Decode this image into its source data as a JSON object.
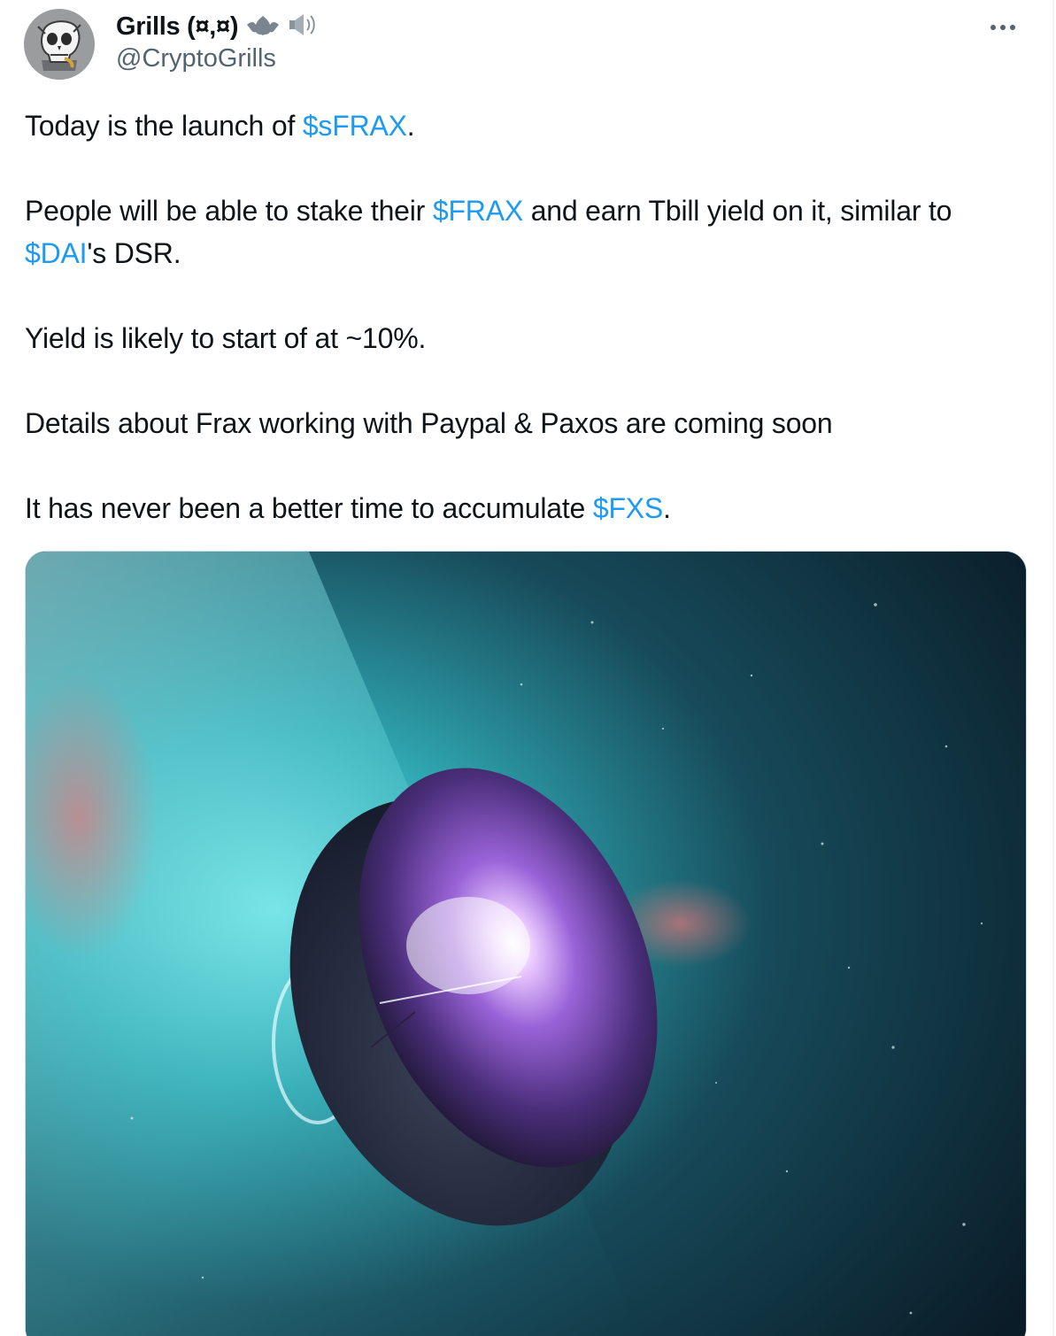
{
  "tweet": {
    "author": {
      "display_name": "Grills (¤,¤)",
      "badge_icons": [
        "bat-icon",
        "speaker-icon"
      ],
      "handle": "@CryptoGrills"
    },
    "more_label": "···",
    "paragraphs": [
      [
        {
          "text": "Today is the launch of "
        },
        {
          "text": "$sFRAX",
          "link": true
        },
        {
          "text": "."
        }
      ],
      [
        {
          "text": "People will be able to stake their "
        },
        {
          "text": "$FRAX",
          "link": true
        },
        {
          "text": " and earn Tbill yield on it, similar to "
        },
        {
          "text": "$DAI",
          "link": true
        },
        {
          "text": "'s DSR."
        }
      ],
      [
        {
          "text": "Yield is likely to start of at ~10%."
        }
      ],
      [
        {
          "text": "Details about Frax working with Paypal & Paxos are coming soon"
        }
      ],
      [
        {
          "text": "It has never been a better time to accumulate "
        },
        {
          "text": "$FXS",
          "link": true
        },
        {
          "text": "."
        }
      ]
    ],
    "media": {
      "kind": "image",
      "subject": "space-orb-illustration"
    },
    "colors": {
      "link": "#1d9bf0",
      "text": "#0f1419",
      "secondary": "#536471"
    }
  }
}
